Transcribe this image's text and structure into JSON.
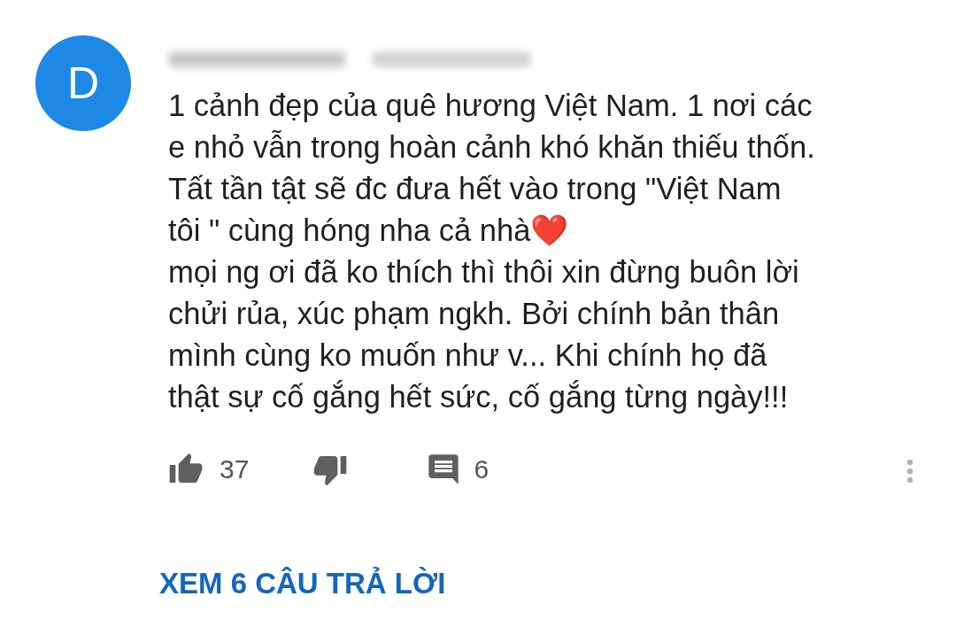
{
  "comment": {
    "avatar_letter": "D",
    "text": "1 cảnh đẹp của quê hương Việt Nam. 1 nơi các\ne nhỏ vẫn trong hoàn cảnh khó khăn thiếu thốn.\nTất tần tật sẽ đc đưa hết vào trong \"Việt Nam\ntôi \" cùng hóng nha cả nhà❤️\nmọi ng ơi đã ko thích thì thôi xin đừng buôn lời\nchửi rủa, xúc phạm ngkh. Bởi chính bản thân\nmình cùng ko muốn như v... Khi chính họ đã\nthật sự cố gắng hết sức, cố gắng từng ngày!!!",
    "likes": "37",
    "replies_count": "6",
    "view_replies": "XEM 6 CÂU TRẢ LỜI"
  }
}
